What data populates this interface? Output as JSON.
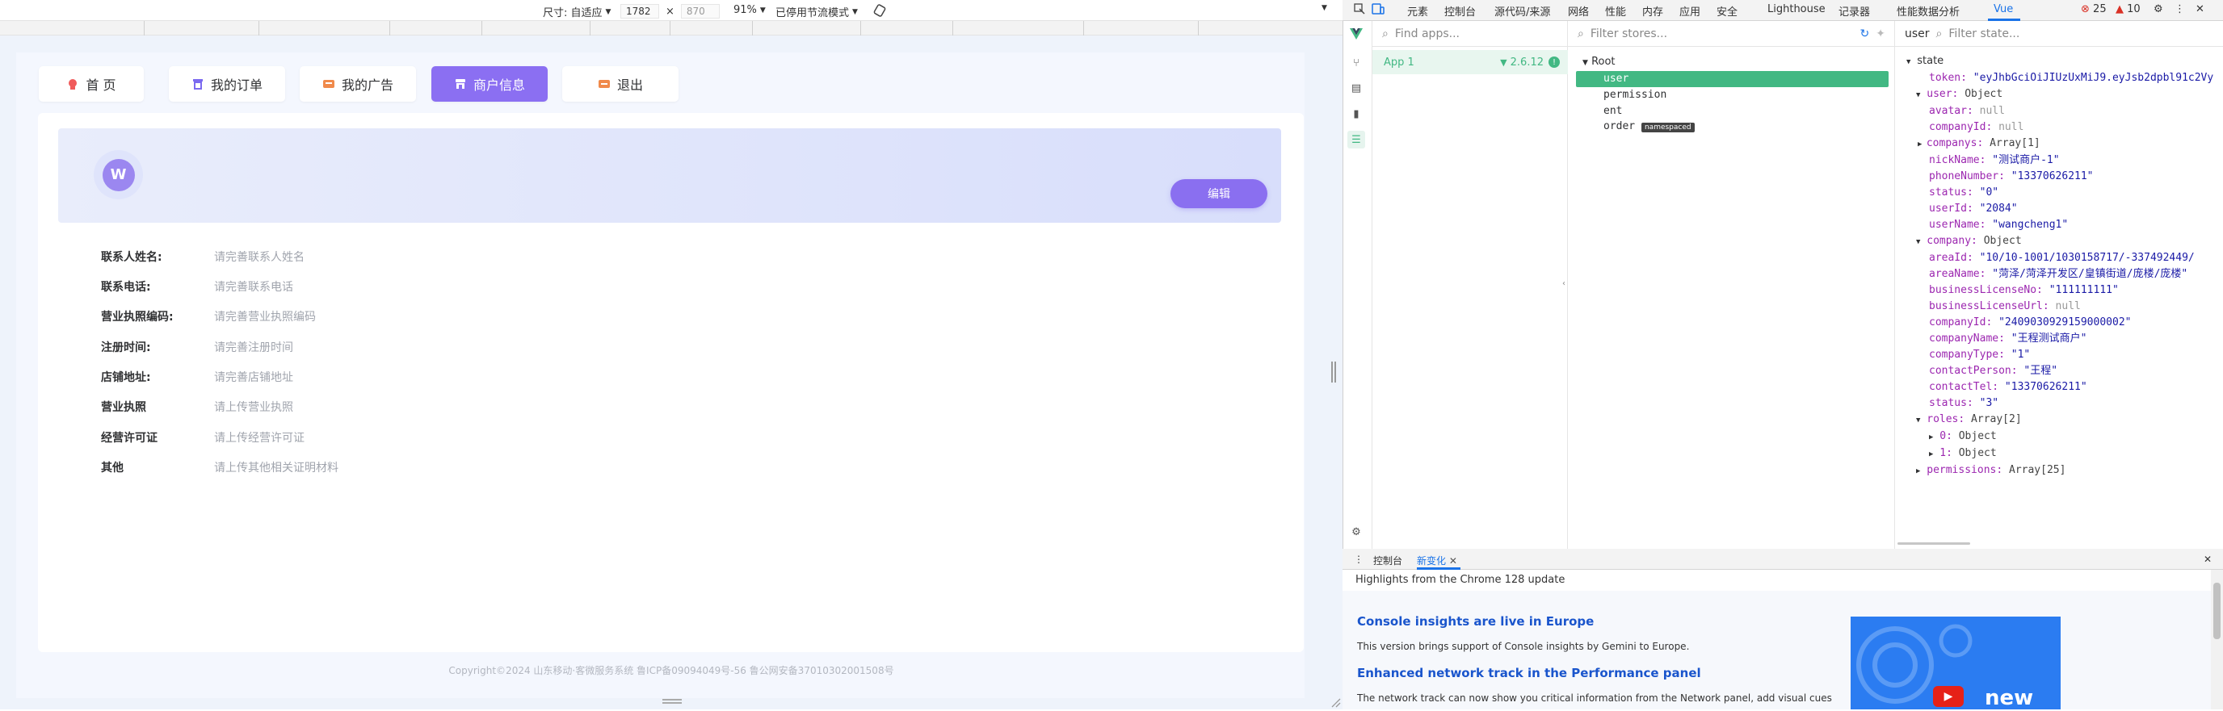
{
  "device_toolbar": {
    "dimensions_label": "尺寸: 自适应",
    "width": "1782",
    "times": "×",
    "height": "870",
    "zoom": "91%",
    "throttle": "已停用节流模式"
  },
  "page": {
    "nav": [
      "首 页",
      "我的订单",
      "我的广告",
      "商户信息",
      "退出"
    ],
    "active_nav": "商户信息",
    "edit_label": "编辑",
    "avatar_text": "W",
    "fields": [
      {
        "label": "联系人姓名:",
        "value": "请完善联系人姓名"
      },
      {
        "label": "联系电话:",
        "value": "请完善联系电话"
      },
      {
        "label": "营业执照编码:",
        "value": "请完善营业执照编码"
      },
      {
        "label": "注册时间:",
        "value": "请完善注册时间"
      },
      {
        "label": "店铺地址:",
        "value": "请完善店铺地址"
      },
      {
        "label": "营业执照",
        "value": "请上传营业执照"
      },
      {
        "label": "经营许可证",
        "value": "请上传经营许可证"
      },
      {
        "label": "其他",
        "value": "请上传其他相关证明材料"
      }
    ],
    "copyright": "Copyright©2024 山东移动·客微服务系统 鲁ICP备09094049号-56 鲁公网安备37010302001508号"
  },
  "devtools": {
    "tabs": [
      "元素",
      "控制台",
      "源代码/来源",
      "网络",
      "性能",
      "内存",
      "应用",
      "安全",
      "Lighthouse",
      "记录器",
      "性能数据分析",
      "Vue"
    ],
    "active_tab": "Vue",
    "errors": "25",
    "warnings": "10",
    "apps_filter_placeholder": "Find apps...",
    "app_name": "App 1",
    "vue_version": "2.6.12",
    "stores_filter_placeholder": "Filter stores...",
    "stores": {
      "root": "Root",
      "children": [
        "user",
        "permission",
        "ent",
        "order"
      ],
      "order_badge": "namespaced",
      "selected": "user"
    },
    "state_title": "user",
    "state_filter_placeholder": "Filter state...",
    "state": {
      "header": "state",
      "token_key": "token:",
      "token_val": "\"eyJhbGciOiJIUzUxMiJ9.eyJsb2dpbl91c2Vy",
      "user_key": "user:",
      "user_type": "Object",
      "user_props": [
        {
          "k": "avatar:",
          "v": "null",
          "t": "nul"
        },
        {
          "k": "companyId:",
          "v": "null",
          "t": "nul"
        },
        {
          "k": "companys:",
          "v": "Array[1]",
          "t": "obj",
          "arrow": true
        },
        {
          "k": "nickName:",
          "v": "\"测试商户-1\"",
          "t": "str"
        },
        {
          "k": "phoneNumber:",
          "v": "\"13370626211\"",
          "t": "str"
        },
        {
          "k": "status:",
          "v": "\"0\"",
          "t": "str"
        },
        {
          "k": "userId:",
          "v": "\"2084\"",
          "t": "str"
        },
        {
          "k": "userName:",
          "v": "\"wangcheng1\"",
          "t": "str"
        }
      ],
      "company_key": "company:",
      "company_type": "Object",
      "company_props": [
        {
          "k": "areaId:",
          "v": "\"10/10-1001/1030158717/-337492449/",
          "t": "str"
        },
        {
          "k": "areaName:",
          "v": "\"菏泽/菏泽开发区/皇镇街道/庞楼/庞楼\"",
          "t": "str"
        },
        {
          "k": "businessLicenseNo:",
          "v": "\"111111111\"",
          "t": "str"
        },
        {
          "k": "businessLicenseUrl:",
          "v": "null",
          "t": "nul"
        },
        {
          "k": "companyId:",
          "v": "\"2409030929159000002\"",
          "t": "str"
        },
        {
          "k": "companyName:",
          "v": "\"王程测试商户\"",
          "t": "str"
        },
        {
          "k": "companyType:",
          "v": "\"1\"",
          "t": "str"
        },
        {
          "k": "contactPerson:",
          "v": "\"王程\"",
          "t": "str"
        },
        {
          "k": "contactTel:",
          "v": "\"13370626211\"",
          "t": "str"
        },
        {
          "k": "status:",
          "v": "\"3\"",
          "t": "str"
        }
      ],
      "roles_key": "roles:",
      "roles_type": "Array[2]",
      "roles_items": [
        {
          "k": "0:",
          "v": "Object"
        },
        {
          "k": "1:",
          "v": "Object"
        }
      ],
      "permissions_key": "permissions:",
      "permissions_type": "Array[25]"
    },
    "drawer": {
      "tabs": [
        "控制台",
        "新变化"
      ],
      "active": "新变化",
      "highlights": "Highlights from the Chrome 128 update",
      "h1": "Console insights are live in Europe",
      "p1": "This version brings support of Console insights by Gemini to Europe.",
      "h2": "Enhanced network track in the Performance panel",
      "p2": "The network track can now show you critical information from the Network panel, add visual cues",
      "video_label": "new"
    }
  },
  "colors": {
    "accent": "#8b6ff2",
    "vue_green": "#42b883",
    "devtools_blue": "#1a73e8"
  }
}
